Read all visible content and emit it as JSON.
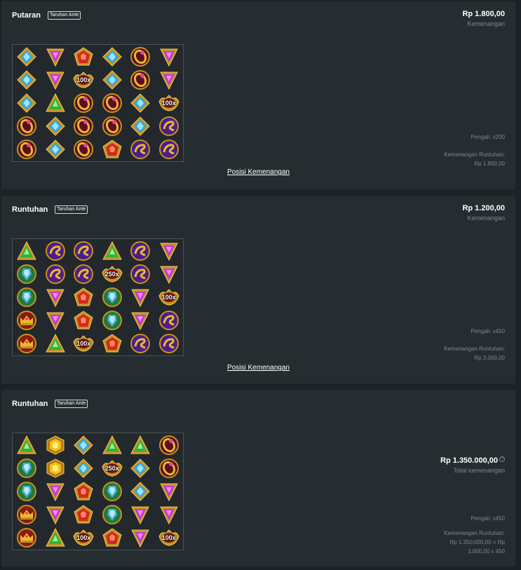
{
  "ante_label": "Taruhan Ante",
  "win_label": "Kemenangan",
  "link_label": "Posisi Kemenangan",
  "cards": [
    {
      "title": "Putaran",
      "amount": "Rp 1.800,00",
      "amount_label": "Kemenangan",
      "multiplier": "Pengali: x200",
      "cascade_label": "Kemenangan Runtuhan:",
      "cascade_value": "Rp 1.800,00",
      "grid": [
        [
          "blue-diamond",
          "purple-triangle",
          "red-pentagon",
          "blue-diamond",
          "red-ring",
          "purple-triangle"
        ],
        [
          "blue-diamond",
          "purple-triangle",
          "mult-100x",
          "blue-diamond",
          "red-ring",
          "purple-triangle"
        ],
        [
          "blue-diamond",
          "green-triangle",
          "red-ring",
          "red-ring",
          "blue-diamond",
          "mult-100x"
        ],
        [
          "red-ring",
          "blue-diamond",
          "red-ring",
          "red-ring",
          "blue-diamond",
          "purple-orb"
        ],
        [
          "red-ring",
          "blue-diamond",
          "red-ring",
          "red-pentagon",
          "purple-orb",
          "purple-orb"
        ]
      ]
    },
    {
      "title": "Runtuhan",
      "amount": "Rp 1.200,00",
      "amount_label": "Kemenangan",
      "multiplier": "Pengali: x450",
      "cascade_label": "Kemenangan Runtuhan:",
      "cascade_value": "Rp 3.000,00",
      "grid": [
        [
          "green-triangle",
          "purple-orb",
          "purple-orb",
          "green-triangle",
          "purple-orb",
          "purple-triangle"
        ],
        [
          "green-orb",
          "purple-orb",
          "purple-orb",
          "mult-250x",
          "purple-orb",
          "purple-triangle"
        ],
        [
          "green-orb",
          "purple-triangle",
          "red-pentagon",
          "green-orb",
          "purple-triangle",
          "mult-100x"
        ],
        [
          "red-crown",
          "purple-triangle",
          "red-pentagon",
          "green-orb",
          "purple-triangle",
          "purple-orb"
        ],
        [
          "red-crown",
          "green-triangle",
          "mult-100x",
          "red-pentagon",
          "purple-orb",
          "purple-orb"
        ]
      ]
    },
    {
      "title": "Runtuhan",
      "amount": "Rp 1.350.000,00",
      "amount_label": "Total kemenangan",
      "multiplier": "Pengali: x450",
      "cascade_label": "Kemenangan Runtuhan:",
      "cascade_value": "Rp 1.350.000,00 = Rp",
      "cascade_value2": "3.000,00 x 450",
      "info_icon": "?",
      "grid": [
        [
          "green-triangle",
          "yellow-hexagon",
          "blue-diamond",
          "green-triangle",
          "green-triangle",
          "red-ring"
        ],
        [
          "green-orb",
          "yellow-hexagon",
          "blue-diamond",
          "mult-250x",
          "blue-diamond",
          "red-ring"
        ],
        [
          "green-orb",
          "purple-triangle",
          "red-pentagon",
          "green-orb",
          "blue-diamond",
          "purple-triangle"
        ],
        [
          "red-crown",
          "purple-triangle",
          "red-pentagon",
          "green-orb",
          "purple-triangle",
          "purple-triangle"
        ],
        [
          "red-crown",
          "green-triangle",
          "mult-100x",
          "red-pentagon",
          "purple-triangle",
          "mult-100x"
        ]
      ]
    }
  ],
  "colors": {
    "background": "#1d2226",
    "card": "#262d31",
    "muted_text": "#7c8790",
    "gold": "#d9a520"
  }
}
